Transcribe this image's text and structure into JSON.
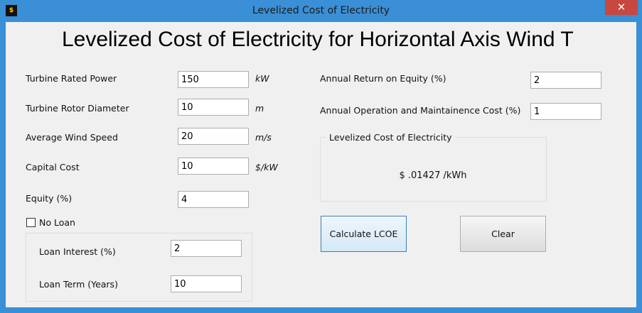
{
  "window": {
    "title": "Levelized Cost of Electricity",
    "close_glyph": "✕"
  },
  "heading": "Levelized Cost of Electricity for Horizontal Axis Wind T",
  "fields": {
    "rated_power": {
      "label": "Turbine Rated Power",
      "value": "150",
      "unit": "kW"
    },
    "rotor_diameter": {
      "label": "Turbine Rotor Diameter",
      "value": "10",
      "unit": "m"
    },
    "wind_speed": {
      "label": "Average Wind Speed",
      "value": "20",
      "unit": "m/s"
    },
    "capital_cost": {
      "label": "Capital Cost",
      "value": "10",
      "unit": "$/kW"
    },
    "equity": {
      "label": "Equity (%)",
      "value": "4"
    },
    "return_on_equity": {
      "label": "Annual Return on Equity (%)",
      "value": "2"
    },
    "om_cost": {
      "label": "Annual Operation and Maintainence Cost (%)",
      "value": "1"
    }
  },
  "no_loan": {
    "label": "No Loan",
    "checked": false
  },
  "loan": {
    "interest": {
      "label": "Loan Interest (%)",
      "value": "2"
    },
    "term": {
      "label": "Loan Term (Years)",
      "value": "10"
    }
  },
  "result": {
    "title": "Levelized Cost of Electricity",
    "value": "$ .01427 /kWh"
  },
  "buttons": {
    "calculate": "Calculate LCOE",
    "clear": "Clear"
  }
}
